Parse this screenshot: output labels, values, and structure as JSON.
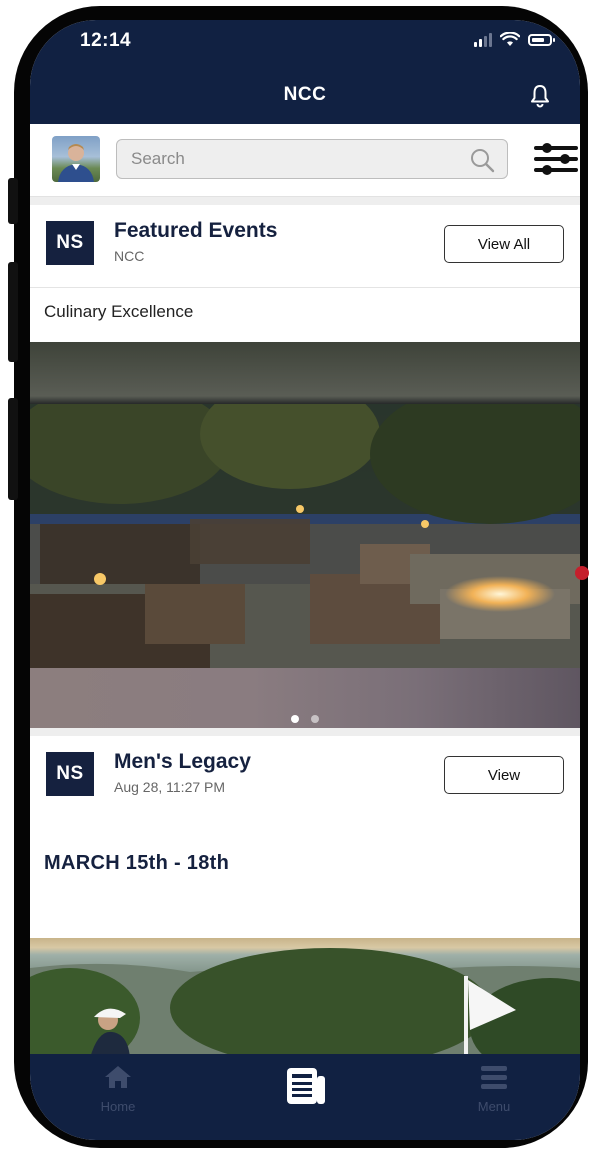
{
  "status_bar": {
    "time": "12:14"
  },
  "header": {
    "title": "NCC",
    "notification_icon": "bell-icon"
  },
  "search": {
    "placeholder": "Search",
    "value": "",
    "filter_icon": "sliders-icon"
  },
  "featured": {
    "logo": "NS",
    "title": "Featured Events",
    "subtitle": "NCC",
    "button_label": "View All",
    "event_name": "Culinary Excellence",
    "carousel_pages": 2,
    "carousel_active_page": 1
  },
  "post": {
    "logo": "NS",
    "title": "Men's Legacy",
    "timestamp": "Aug 28, 11:27 PM",
    "button_label": "View",
    "headline": "MARCH 15th - 18th"
  },
  "tabbar": {
    "items": [
      {
        "label": "Home",
        "icon": "home-icon"
      },
      {
        "label": "",
        "icon": "newspaper-icon",
        "active": true
      },
      {
        "label": "Menu",
        "icon": "hamburger-icon"
      }
    ]
  },
  "colors": {
    "navy": "#112142",
    "brand_dark": "#15213f",
    "tab_inactive": "#3e4c6c",
    "tab_active": "#ffffff"
  }
}
